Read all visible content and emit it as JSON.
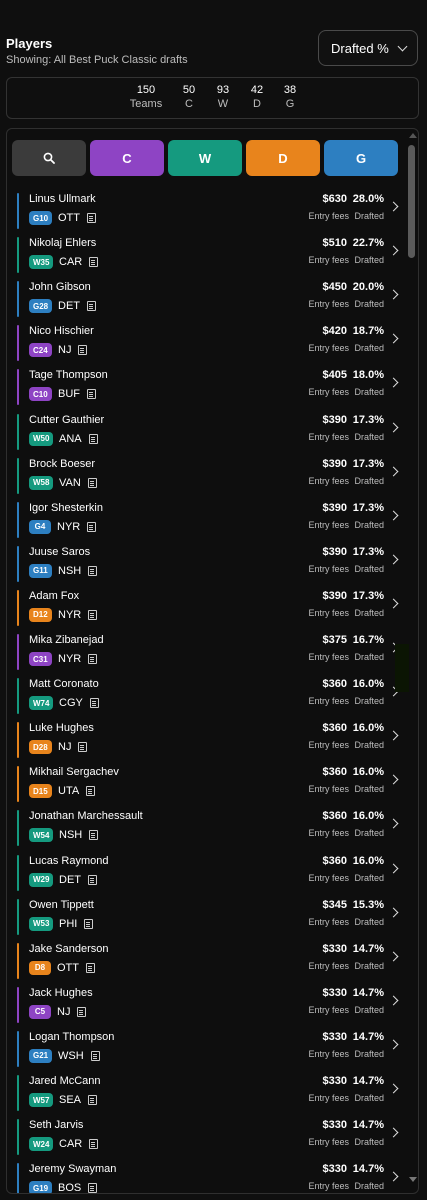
{
  "header": {
    "title": "Players",
    "subtitle": "Showing: All Best Puck Classic drafts",
    "sort_label": "Drafted %"
  },
  "stats": [
    {
      "value": "150",
      "label": "Teams"
    },
    {
      "value": "50",
      "label": "C"
    },
    {
      "value": "93",
      "label": "W"
    },
    {
      "value": "42",
      "label": "D"
    },
    {
      "value": "38",
      "label": "G"
    }
  ],
  "tabs": [
    {
      "label": "",
      "icon": "search-icon",
      "color": "#3b3b3b"
    },
    {
      "label": "C",
      "color": "#8e44c4"
    },
    {
      "label": "W",
      "color": "#159a7f"
    },
    {
      "label": "D",
      "color": "#e8841c"
    },
    {
      "label": "G",
      "color": "#2d7fc1"
    }
  ],
  "position_colors": {
    "C": "#8e44c4",
    "W": "#159a7f",
    "D": "#e8841c",
    "G": "#2d7fc1"
  },
  "labels": {
    "entry_fees": "Entry fees",
    "drafted": "Drafted"
  },
  "players": [
    {
      "name": "Linus Ullmark",
      "pos": "G",
      "badge": "G10",
      "team": "OTT",
      "fee": "$630",
      "pct": "28.0%"
    },
    {
      "name": "Nikolaj Ehlers",
      "pos": "W",
      "badge": "W35",
      "team": "CAR",
      "fee": "$510",
      "pct": "22.7%"
    },
    {
      "name": "John Gibson",
      "pos": "G",
      "badge": "G28",
      "team": "DET",
      "fee": "$450",
      "pct": "20.0%"
    },
    {
      "name": "Nico Hischier",
      "pos": "C",
      "badge": "C24",
      "team": "NJ",
      "fee": "$420",
      "pct": "18.7%"
    },
    {
      "name": "Tage Thompson",
      "pos": "C",
      "badge": "C10",
      "team": "BUF",
      "fee": "$405",
      "pct": "18.0%"
    },
    {
      "name": "Cutter Gauthier",
      "pos": "W",
      "badge": "W50",
      "team": "ANA",
      "fee": "$390",
      "pct": "17.3%"
    },
    {
      "name": "Brock Boeser",
      "pos": "W",
      "badge": "W58",
      "team": "VAN",
      "fee": "$390",
      "pct": "17.3%"
    },
    {
      "name": "Igor Shesterkin",
      "pos": "G",
      "badge": "G4",
      "team": "NYR",
      "fee": "$390",
      "pct": "17.3%"
    },
    {
      "name": "Juuse Saros",
      "pos": "G",
      "badge": "G11",
      "team": "NSH",
      "fee": "$390",
      "pct": "17.3%"
    },
    {
      "name": "Adam Fox",
      "pos": "D",
      "badge": "D12",
      "team": "NYR",
      "fee": "$390",
      "pct": "17.3%"
    },
    {
      "name": "Mika Zibanejad",
      "pos": "C",
      "badge": "C31",
      "team": "NYR",
      "fee": "$375",
      "pct": "16.7%"
    },
    {
      "name": "Matt Coronato",
      "pos": "W",
      "badge": "W74",
      "team": "CGY",
      "fee": "$360",
      "pct": "16.0%"
    },
    {
      "name": "Luke Hughes",
      "pos": "D",
      "badge": "D28",
      "team": "NJ",
      "fee": "$360",
      "pct": "16.0%"
    },
    {
      "name": "Mikhail Sergachev",
      "pos": "D",
      "badge": "D15",
      "team": "UTA",
      "fee": "$360",
      "pct": "16.0%"
    },
    {
      "name": "Jonathan Marchessault",
      "pos": "W",
      "badge": "W54",
      "team": "NSH",
      "fee": "$360",
      "pct": "16.0%"
    },
    {
      "name": "Lucas Raymond",
      "pos": "W",
      "badge": "W29",
      "team": "DET",
      "fee": "$360",
      "pct": "16.0%"
    },
    {
      "name": "Owen Tippett",
      "pos": "W",
      "badge": "W53",
      "team": "PHI",
      "fee": "$345",
      "pct": "15.3%"
    },
    {
      "name": "Jake Sanderson",
      "pos": "D",
      "badge": "D8",
      "team": "OTT",
      "fee": "$330",
      "pct": "14.7%"
    },
    {
      "name": "Jack Hughes",
      "pos": "C",
      "badge": "C5",
      "team": "NJ",
      "fee": "$330",
      "pct": "14.7%"
    },
    {
      "name": "Logan Thompson",
      "pos": "G",
      "badge": "G21",
      "team": "WSH",
      "fee": "$330",
      "pct": "14.7%"
    },
    {
      "name": "Jared McCann",
      "pos": "W",
      "badge": "W57",
      "team": "SEA",
      "fee": "$330",
      "pct": "14.7%"
    },
    {
      "name": "Seth Jarvis",
      "pos": "W",
      "badge": "W24",
      "team": "CAR",
      "fee": "$330",
      "pct": "14.7%"
    },
    {
      "name": "Jeremy Swayman",
      "pos": "G",
      "badge": "G19",
      "team": "BOS",
      "fee": "$330",
      "pct": "14.7%"
    }
  ]
}
